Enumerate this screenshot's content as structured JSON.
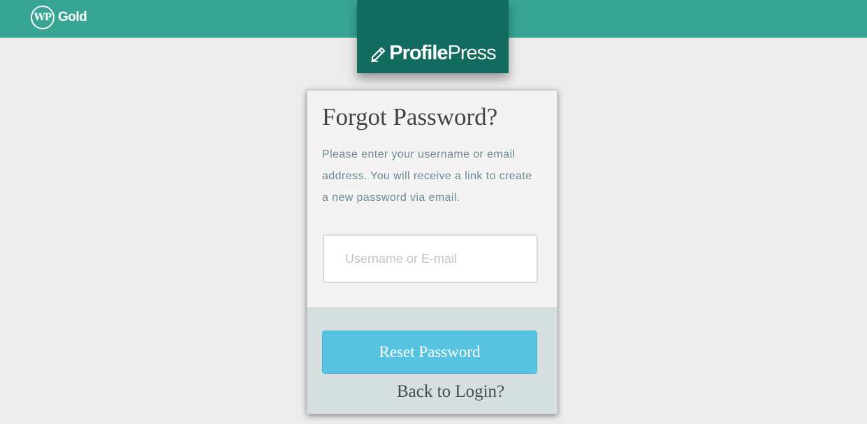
{
  "header": {
    "wp_logo_text": "WP",
    "wp_brand_suffix": "Gold",
    "plugin_brand_bold": "Profile",
    "plugin_brand_light": "Press",
    "bar_color": "#38a594",
    "tab_color": "#126b5f"
  },
  "form": {
    "title": "Forgot Password?",
    "description": "Please enter your username or email address. You will receive a link to create a new password via email.",
    "username_input": {
      "placeholder": "Username or E-mail",
      "value": ""
    },
    "submit_label": "Reset Password",
    "back_link_label": "Back to Login?",
    "button_color": "#58c3e1"
  },
  "icons": {
    "brand_icon": "pen-icon"
  }
}
